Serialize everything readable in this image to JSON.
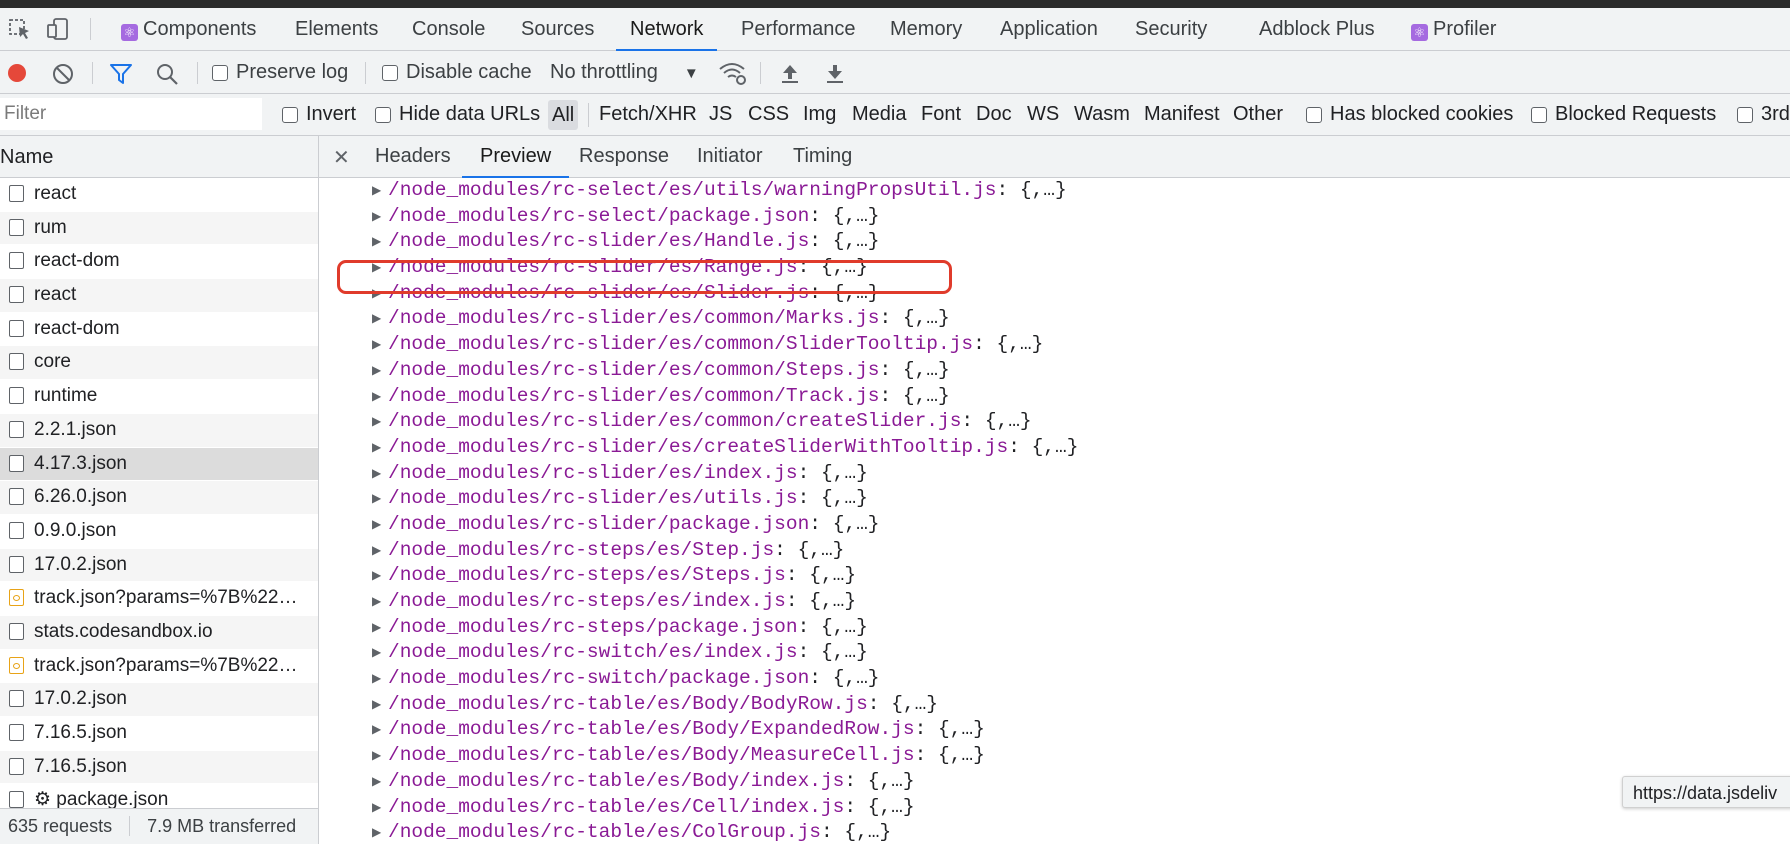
{
  "panel_tabs": [
    {
      "label": "Components",
      "badge": true
    },
    {
      "label": "Elements"
    },
    {
      "label": "Console"
    },
    {
      "label": "Sources"
    },
    {
      "label": "Network",
      "active": true
    },
    {
      "label": "Performance"
    },
    {
      "label": "Memory"
    },
    {
      "label": "Application"
    },
    {
      "label": "Security"
    },
    {
      "label": "Adblock Plus"
    },
    {
      "label": "Profiler",
      "badge": true
    }
  ],
  "toolbar": {
    "preserve_log": "Preserve log",
    "disable_cache": "Disable cache",
    "throttling": "No throttling"
  },
  "filterbar": {
    "placeholder": "Filter",
    "invert": "Invert",
    "hide_data_urls": "Hide data URLs",
    "types": [
      "All",
      "Fetch/XHR",
      "JS",
      "CSS",
      "Img",
      "Media",
      "Font",
      "Doc",
      "WS",
      "Wasm",
      "Manifest",
      "Other"
    ],
    "has_blocked_cookies": "Has blocked cookies",
    "blocked_requests": "Blocked Requests",
    "third_party": "3rd"
  },
  "name_column": "Name",
  "requests": [
    {
      "name": "react"
    },
    {
      "name": "rum"
    },
    {
      "name": "react-dom"
    },
    {
      "name": "react"
    },
    {
      "name": "react-dom"
    },
    {
      "name": "core"
    },
    {
      "name": "runtime"
    },
    {
      "name": "2.2.1.json"
    },
    {
      "name": "4.17.3.json",
      "selected": true
    },
    {
      "name": "6.26.0.json"
    },
    {
      "name": "0.9.0.json"
    },
    {
      "name": "17.0.2.json"
    },
    {
      "name": "track.json?params=%7B%22…",
      "json_icon": true
    },
    {
      "name": "stats.codesandbox.io"
    },
    {
      "name": "track.json?params=%7B%22…",
      "json_icon": true
    },
    {
      "name": "17.0.2.json"
    },
    {
      "name": "7.16.5.json"
    },
    {
      "name": "7.16.5.json"
    },
    {
      "name": "⚙ package.json"
    }
  ],
  "footer": {
    "requests": "635 requests",
    "transferred": "7.9 MB transferred"
  },
  "detail_tabs": [
    "Headers",
    "Preview",
    "Response",
    "Initiator",
    "Timing"
  ],
  "detail_active": "Preview",
  "tree": [
    "/node_modules/rc-select/es/utils/warningPropsUtil.js",
    "/node_modules/rc-select/package.json",
    "/node_modules/rc-slider/es/Handle.js",
    "/node_modules/rc-slider/es/Range.js",
    "/node_modules/rc-slider/es/Slider.js",
    "/node_modules/rc-slider/es/common/Marks.js",
    "/node_modules/rc-slider/es/common/SliderTooltip.js",
    "/node_modules/rc-slider/es/common/Steps.js",
    "/node_modules/rc-slider/es/common/Track.js",
    "/node_modules/rc-slider/es/common/createSlider.js",
    "/node_modules/rc-slider/es/createSliderWithTooltip.js",
    "/node_modules/rc-slider/es/index.js",
    "/node_modules/rc-slider/es/utils.js",
    "/node_modules/rc-slider/package.json",
    "/node_modules/rc-steps/es/Step.js",
    "/node_modules/rc-steps/es/Steps.js",
    "/node_modules/rc-steps/es/index.js",
    "/node_modules/rc-steps/package.json",
    "/node_modules/rc-switch/es/index.js",
    "/node_modules/rc-switch/package.json",
    "/node_modules/rc-table/es/Body/BodyRow.js",
    "/node_modules/rc-table/es/Body/ExpandedRow.js",
    "/node_modules/rc-table/es/Body/MeasureCell.js",
    "/node_modules/rc-table/es/Body/index.js",
    "/node_modules/rc-table/es/Cell/index.js",
    "/node_modules/rc-table/es/ColGroup.js"
  ],
  "tree_value": "{,…}",
  "tooltip": "https://data.jsdeliv",
  "colors": {
    "accent": "#1a73e8",
    "record": "#e5483a",
    "highlight": "#e03b2b",
    "key": "#8a1a95"
  }
}
